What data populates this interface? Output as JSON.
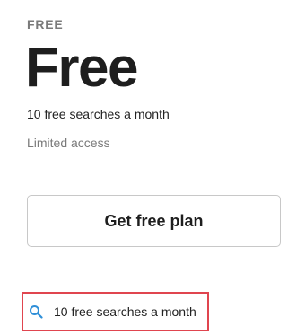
{
  "plan": {
    "tier_label": "FREE",
    "name": "Free",
    "description": "10 free searches a month",
    "access": "Limited access",
    "cta_label": "Get free plan"
  },
  "features": [
    {
      "icon": "search-icon",
      "text": "10 free searches a month"
    }
  ],
  "colors": {
    "accent": "#2f8fd8",
    "highlight_border": "#e0454f",
    "muted_text": "#7a7a7a",
    "button_border": "#c8c8c8"
  }
}
